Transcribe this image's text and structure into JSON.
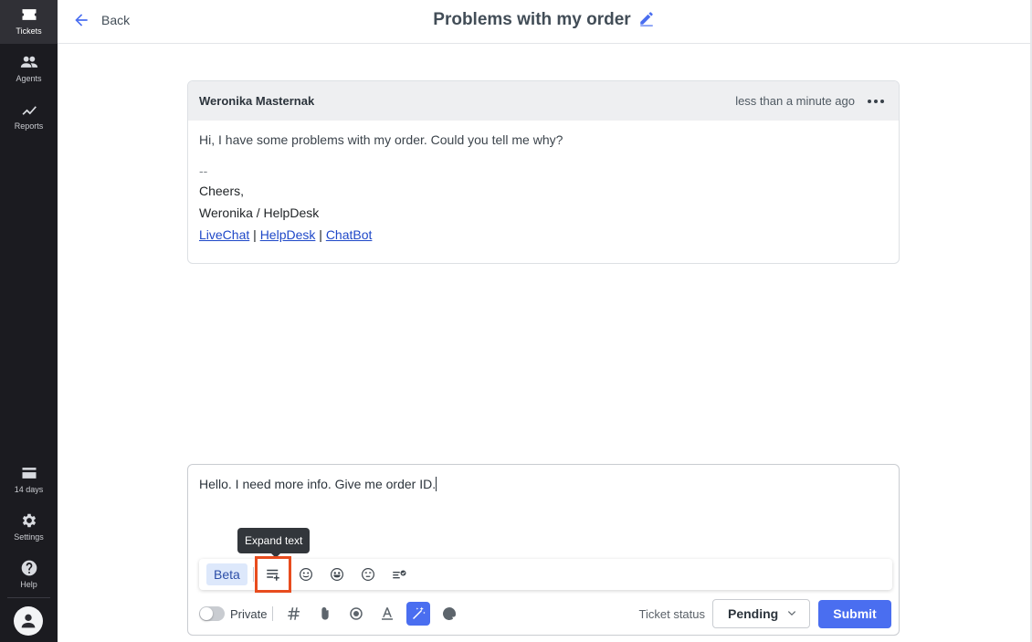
{
  "sidebar": {
    "items": [
      {
        "label": "Tickets",
        "icon": "tickets-icon"
      },
      {
        "label": "Agents",
        "icon": "agents-icon"
      },
      {
        "label": "Reports",
        "icon": "reports-icon"
      }
    ],
    "bottom": [
      {
        "label": "14 days",
        "icon": "trial-card-icon"
      },
      {
        "label": "Settings",
        "icon": "gear-icon"
      },
      {
        "label": "Help",
        "icon": "help-icon"
      }
    ]
  },
  "header": {
    "back_label": "Back",
    "title": "Problems with my order"
  },
  "message": {
    "author": "Weronika Masternak",
    "time": "less than a minute ago",
    "text": "Hi, I have some problems with my order. Could you tell me why?",
    "signature": {
      "dash": "--",
      "greeting": "Cheers,",
      "name": "Weronika / HelpDesk",
      "links": [
        "LiveChat",
        "HelpDesk",
        "ChatBot"
      ],
      "link_separator": "|"
    }
  },
  "composer": {
    "text": "Hello. I need more info. Give me order ID.",
    "tooltip": "Expand text",
    "beta_label": "Beta",
    "private_label": "Private",
    "ticket_status_label": "Ticket status",
    "ticket_status_value": "Pending",
    "submit_label": "Submit"
  },
  "colors": {
    "accent": "#4a6ef0",
    "highlight": "#e84c1e",
    "sidebar_bg": "#1b1b20"
  }
}
